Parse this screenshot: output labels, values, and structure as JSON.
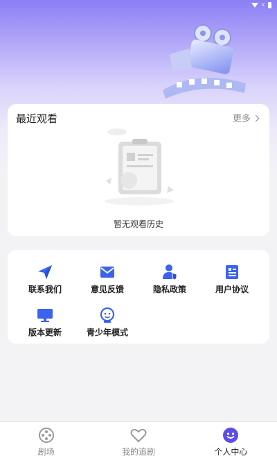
{
  "status_bar": {
    "signal_text": "x"
  },
  "recent": {
    "title": "最近观看",
    "more_label": "更多",
    "empty_text": "暂无观看历史"
  },
  "menu": {
    "items": [
      {
        "label": "联系我们",
        "icon": "paper-plane-icon"
      },
      {
        "label": "意见反馈",
        "icon": "envelope-icon"
      },
      {
        "label": "隐私政策",
        "icon": "user-shield-icon"
      },
      {
        "label": "用户协议",
        "icon": "document-icon"
      },
      {
        "label": "版本更新",
        "icon": "monitor-icon"
      },
      {
        "label": "青少年模式",
        "icon": "child-face-icon"
      }
    ]
  },
  "tabbar": {
    "tabs": [
      {
        "label": "剧场",
        "icon": "film-reel-icon",
        "active": false
      },
      {
        "label": "我的追剧",
        "icon": "heart-icon",
        "active": false
      },
      {
        "label": "个人中心",
        "icon": "smile-face-icon",
        "active": true
      }
    ]
  },
  "colors": {
    "accent": "#3a63f0",
    "tab_active": "#5b4ee8",
    "tab_inactive": "#999999"
  }
}
